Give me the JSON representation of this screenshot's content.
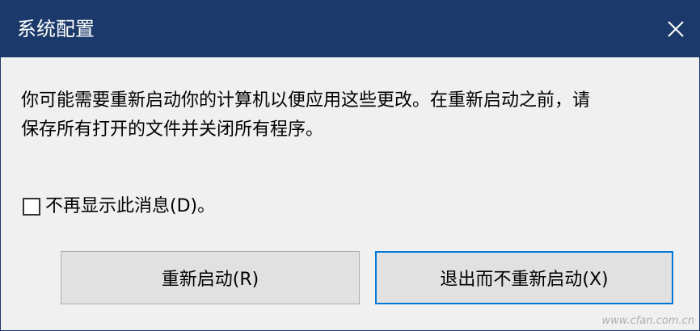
{
  "window": {
    "title": "系统配置",
    "close_icon": "close-icon"
  },
  "message": {
    "line1": "你可能需要重新启动你的计算机以便应用这些更改。在重新启动之前，请",
    "line2": "保存所有打开的文件并关闭所有程序。"
  },
  "checkbox": {
    "label": "不再显示此消息(D)。",
    "checked": false
  },
  "buttons": {
    "restart_label": "重新启动(R)",
    "exit_label": "退出而不重新启动(X)"
  },
  "watermark": "www.cfan.com.cn",
  "colors": {
    "titlebar": "#1b3a6b",
    "body": "#f0f0f0",
    "button": "#e1e1e1",
    "focus_border": "#0078d7"
  }
}
